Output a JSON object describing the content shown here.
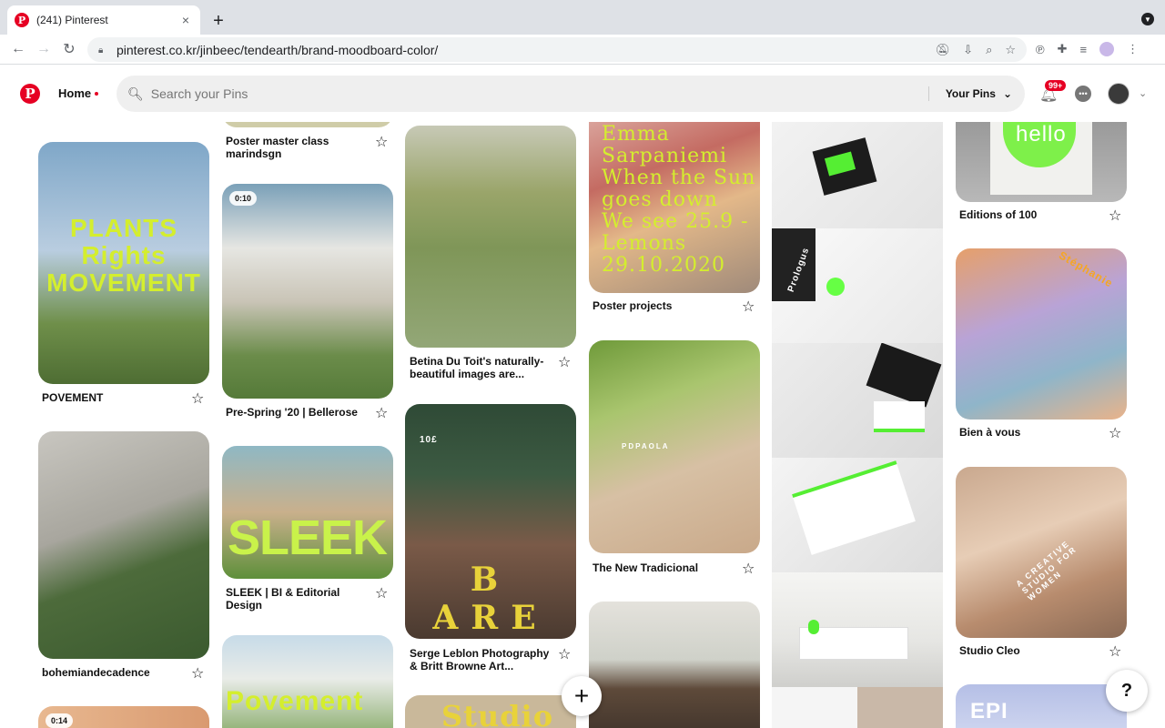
{
  "browser": {
    "tab_title": "(241) Pinterest",
    "tab_close": "×",
    "new_tab": "+",
    "url": "pinterest.co.kr/jinbeec/tendearth/brand-moodboard-color/",
    "back": "←",
    "forward": "→",
    "reload": "↻"
  },
  "header": {
    "logo": "P",
    "home_label": "Home",
    "search_placeholder": "Search your Pins",
    "your_pins": "Your Pins",
    "notification_badge": "99+",
    "accent": "#e60023"
  },
  "pins": [
    {
      "caption": "Poster master class marindsgn"
    },
    {
      "caption": "POVEMENT",
      "image_text": "PLANTS Rights MOVEMENT"
    },
    {
      "caption": "Pre-Spring '20 | Bellerose",
      "video_time": "0:10"
    },
    {
      "caption": "Betina Du Toit's naturally-beautiful images are..."
    },
    {
      "caption": "Poster projects",
      "image_text": "Emma Sarpaniemi When the Sun goes down We see 25.9 - Lemons 29.10.2020"
    },
    {
      "caption": "Editions of 100",
      "image_text": "hello"
    },
    {
      "caption": "Bien à vous",
      "image_text": "Stéphanie"
    },
    {
      "caption": "bohemiandecadence"
    },
    {
      "caption": "SLEEK | BI & Editorial Design",
      "image_text": "SLEEK"
    },
    {
      "caption": "Serge Leblon Photography & Britt Browne Art...",
      "image_text": "B ARE",
      "price_text": "10£"
    },
    {
      "caption": "The New Tradicional",
      "image_text": "PDPAOLA"
    },
    {
      "caption": "Studio Cleo",
      "image_text": "A CREATIVE STUDIO FOR WOMEN"
    },
    {
      "caption": "",
      "image_text": "Povement"
    },
    {
      "caption": "",
      "image_text": "Studio"
    },
    {
      "caption": "",
      "image_text": "EPI"
    },
    {
      "caption": "",
      "video_time": "0:14"
    }
  ],
  "stationery_text": "Prologus",
  "fab": "+",
  "help": "?"
}
